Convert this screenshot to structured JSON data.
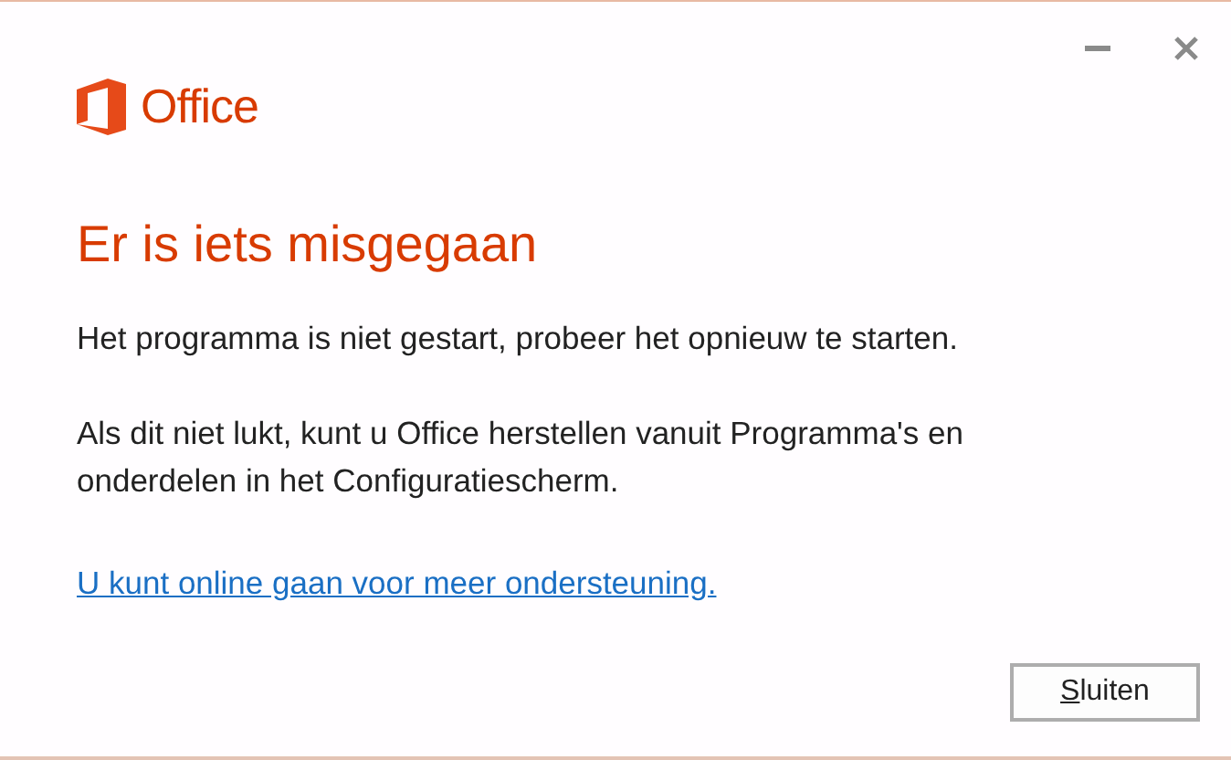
{
  "window": {
    "controls": [
      {
        "kind": "minimize"
      },
      {
        "kind": "close"
      }
    ]
  },
  "brand": {
    "name": "Office"
  },
  "heading": "Er is iets misgegaan",
  "paragraphs": [
    "Het programma is niet gestart, probeer het opnieuw te starten.",
    "Als dit niet lukt, kunt u Office herstellen vanuit Programma's en onderdelen in het Configuratiescherm."
  ],
  "link": "U kunt online gaan voor meer ondersteuning.",
  "buttons": [
    {
      "label": "Sluiten",
      "access_key_underlined": true
    }
  ]
}
